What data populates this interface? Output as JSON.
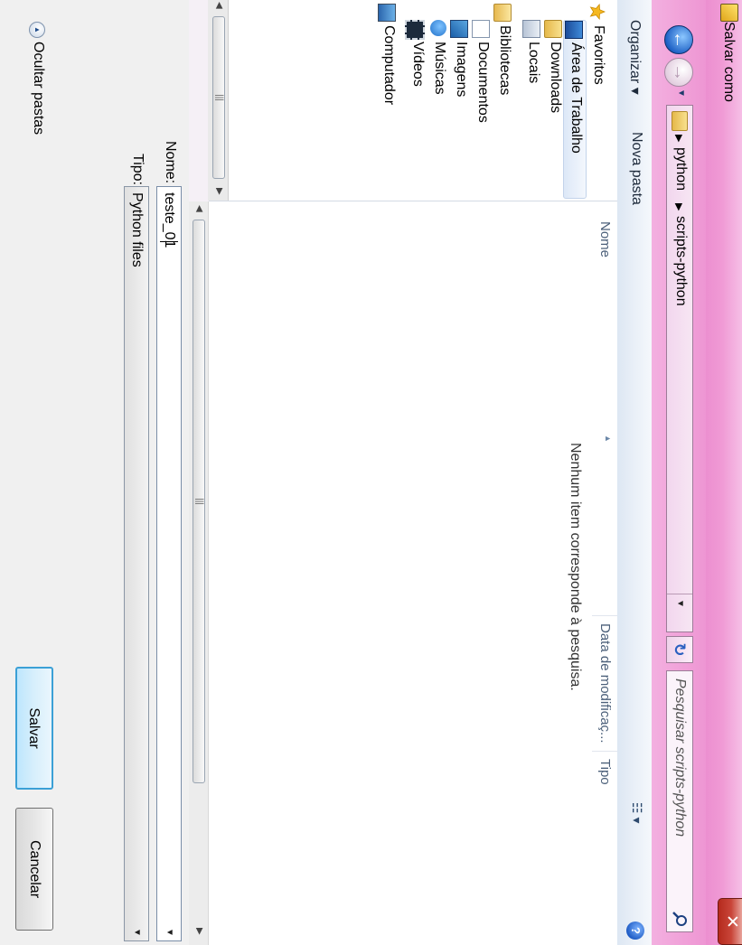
{
  "window": {
    "title": "Salvar como",
    "close_label": "✕"
  },
  "nav": {
    "breadcrumb": [
      "python",
      "scripts-python"
    ],
    "breadcrumb_separator": "▸",
    "search_placeholder": "Pesquisar scripts-python"
  },
  "toolbar": {
    "organize_label": "Organizar ▾",
    "new_folder_label": "Nova pasta"
  },
  "sidebar": {
    "items": [
      {
        "label": "Favoritos",
        "icon": "star-icon"
      },
      {
        "label": "Área de Trabalho",
        "icon": "desktop-icon"
      },
      {
        "label": "Downloads",
        "icon": "downloads-folder-icon"
      },
      {
        "label": "Locais",
        "icon": "places-icon"
      },
      {
        "label": "Bibliotecas",
        "icon": "libraries-icon"
      },
      {
        "label": "Documentos",
        "icon": "documents-icon"
      },
      {
        "label": "Imagens",
        "icon": "pictures-icon"
      },
      {
        "label": "Músicas",
        "icon": "music-icon"
      },
      {
        "label": "Vídeos",
        "icon": "videos-icon"
      },
      {
        "label": "Computador",
        "icon": "computer-icon"
      }
    ]
  },
  "file_list": {
    "columns": [
      "Nome",
      "Data de modificaç...",
      "Tipo"
    ],
    "empty_message": "Nenhum item corresponde à pesquisa."
  },
  "form": {
    "name_label": "Nome:",
    "name_value": "teste_01",
    "type_label": "Tipo:",
    "type_value": "Python files",
    "hide_folders_label": "Ocultar pastas",
    "save_label": "Salvar",
    "cancel_label": "Cancelar"
  },
  "colors": {
    "titlebar": "#f09ad5",
    "save_button_border": "#3ba0d6",
    "close_button": "#c9463a"
  }
}
